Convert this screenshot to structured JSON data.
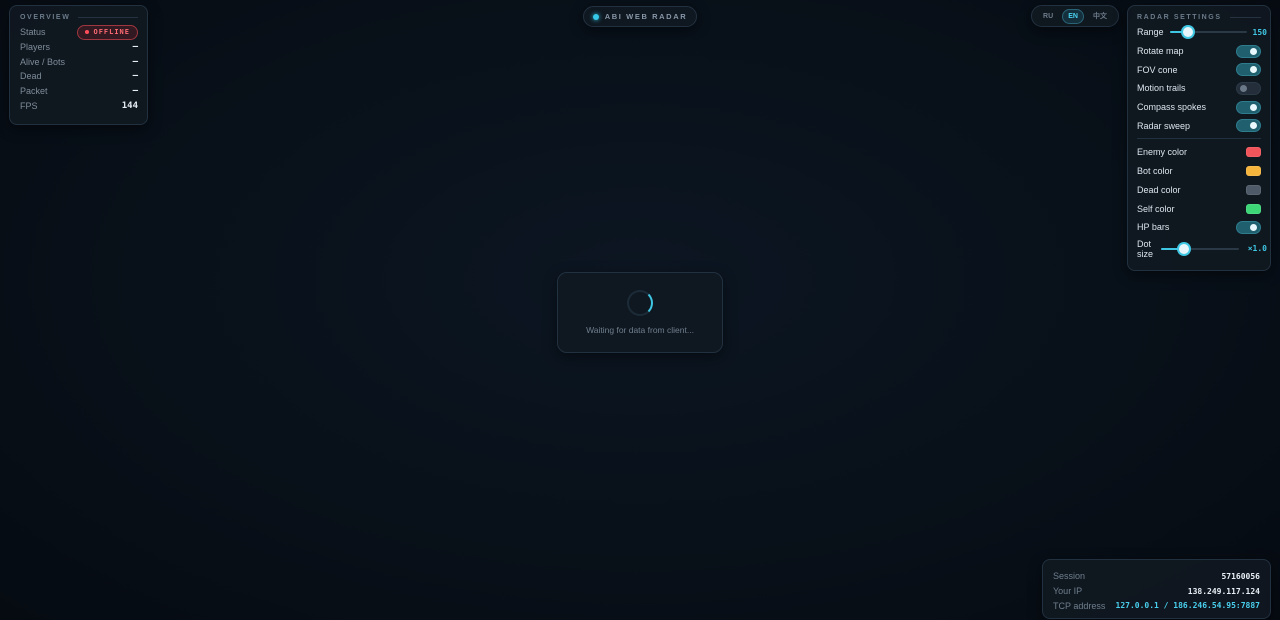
{
  "overview": {
    "title": "OVERVIEW",
    "rows": [
      {
        "label": "Status",
        "value": "OFFLINE"
      },
      {
        "label": "Players",
        "value": "–"
      },
      {
        "label": "Alive / Bots",
        "value": "–"
      },
      {
        "label": "Dead",
        "value": "–"
      },
      {
        "label": "Packet",
        "value": "–"
      },
      {
        "label": "FPS",
        "value": "144"
      }
    ]
  },
  "header": {
    "title": "ABI WEB RADAR"
  },
  "languages": {
    "items": [
      "RU",
      "EN",
      "中文"
    ],
    "selected": "EN"
  },
  "settings": {
    "title": "RADAR SETTINGS",
    "range": {
      "label": "Range",
      "value": "150",
      "fraction": 0.24
    },
    "toggles": [
      {
        "label": "Rotate map",
        "on": true
      },
      {
        "label": "FOV cone",
        "on": true
      },
      {
        "label": "Motion trails",
        "on": false
      },
      {
        "label": "Compass spokes",
        "on": true
      },
      {
        "label": "Radar sweep",
        "on": true
      }
    ],
    "colors": [
      {
        "label": "Enemy color",
        "color": "#f2545b"
      },
      {
        "label": "Bot color",
        "color": "#f5b53d"
      },
      {
        "label": "Dead color",
        "color": "#4e5a68"
      },
      {
        "label": "Self color",
        "color": "#3dd778"
      }
    ],
    "hp_bars": {
      "label": "HP bars",
      "on": true
    },
    "dot_size": {
      "label": "Dot size",
      "value": "×1.0",
      "fraction": 0.3
    }
  },
  "loader": {
    "text": "Waiting for data from client..."
  },
  "connection": {
    "rows": [
      {
        "label": "Session",
        "value": "57160056"
      },
      {
        "label": "Your IP",
        "value": "138.249.117.124"
      },
      {
        "label": "TCP address",
        "value": "127.0.0.1 / 186.246.54.95:7887"
      }
    ]
  },
  "colors": {
    "accent": "#3fc6e2",
    "offline": "#ff4d5a",
    "background": "#081019"
  }
}
